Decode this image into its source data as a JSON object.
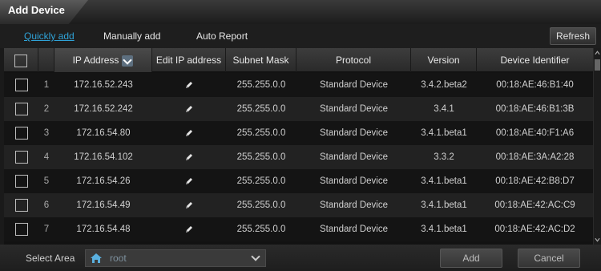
{
  "window": {
    "title": "Add Device"
  },
  "tabs": [
    {
      "label": "Quickly add",
      "active": true
    },
    {
      "label": "Manually add",
      "active": false
    },
    {
      "label": "Auto Report",
      "active": false
    }
  ],
  "toolbar": {
    "refresh_label": "Refresh"
  },
  "table": {
    "headers": {
      "ip": "IP Address",
      "edit": "Edit IP address",
      "subnet": "Subnet Mask",
      "protocol": "Protocol",
      "version": "Version",
      "identifier": "Device Identifier"
    },
    "rows": [
      {
        "num": "1",
        "ip": "172.16.52.243",
        "subnet": "255.255.0.0",
        "protocol": "Standard Device",
        "version": "3.4.2.beta2",
        "identifier": "00:18:AE:46:B1:40"
      },
      {
        "num": "2",
        "ip": "172.16.52.242",
        "subnet": "255.255.0.0",
        "protocol": "Standard Device",
        "version": "3.4.1",
        "identifier": "00:18:AE:46:B1:3B"
      },
      {
        "num": "3",
        "ip": "172.16.54.80",
        "subnet": "255.255.0.0",
        "protocol": "Standard Device",
        "version": "3.4.1.beta1",
        "identifier": "00:18:AE:40:F1:A6"
      },
      {
        "num": "4",
        "ip": "172.16.54.102",
        "subnet": "255.255.0.0",
        "protocol": "Standard Device",
        "version": "3.3.2",
        "identifier": "00:18:AE:3A:A2:28"
      },
      {
        "num": "5",
        "ip": "172.16.54.26",
        "subnet": "255.255.0.0",
        "protocol": "Standard Device",
        "version": "3.4.1.beta1",
        "identifier": "00:18:AE:42:B8:D7"
      },
      {
        "num": "6",
        "ip": "172.16.54.49",
        "subnet": "255.255.0.0",
        "protocol": "Standard Device",
        "version": "3.4.1.beta1",
        "identifier": "00:18:AE:42:AC:C9"
      },
      {
        "num": "7",
        "ip": "172.16.54.48",
        "subnet": "255.255.0.0",
        "protocol": "Standard Device",
        "version": "3.4.1.beta1",
        "identifier": "00:18:AE:42:AC:D2"
      }
    ]
  },
  "footer": {
    "area_label": "Select Area",
    "area_value": "root",
    "add_label": "Add",
    "cancel_label": "Cancel"
  },
  "icons": {
    "sort": "chevron-down-icon",
    "edit": "pencil-icon",
    "area": "home-icon"
  },
  "colors": {
    "accent": "#2fa3d8",
    "area_icon": "#5ab0e0"
  }
}
